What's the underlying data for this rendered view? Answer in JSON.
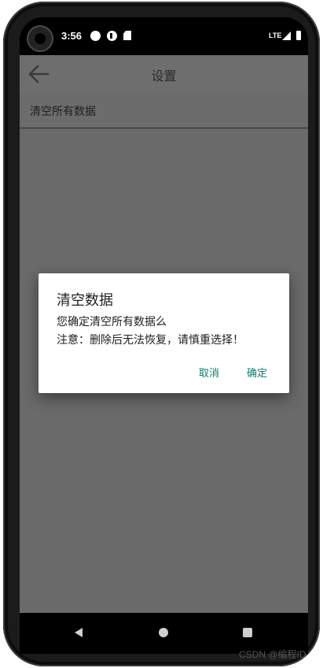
{
  "status_bar": {
    "time": "3:56",
    "network": "LTE",
    "icons": [
      "circle-notification-icon",
      "pocket-icon",
      "sd-card-icon",
      "signal-icon",
      "battery-icon"
    ]
  },
  "toolbar": {
    "title": "设置",
    "back_icon": "arrow-left-icon"
  },
  "settings": {
    "items": [
      {
        "label": "清空所有数据"
      }
    ]
  },
  "dialog": {
    "title": "清空数据",
    "message_line1": "您确定清空所有数据么",
    "message_line2": "注意：删除后无法恢复，请慎重选择！",
    "cancel_label": "取消",
    "confirm_label": "确定"
  },
  "watermark": {
    "text": "CSDN @编程ID"
  },
  "colors": {
    "accent": "#0d7d6c",
    "scrim": "#6a6a6a",
    "dialog_bg": "#ffffff"
  }
}
